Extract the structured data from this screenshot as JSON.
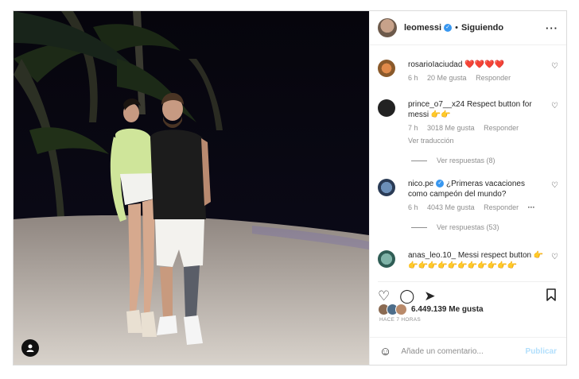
{
  "colors": {
    "accent": "#3897f0",
    "muted": "#8e8e8e",
    "publish_disabled": "#b2dffc"
  },
  "post": {
    "user_tag_icon": "person-icon",
    "header": {
      "username": "leomessi",
      "verified": "✓",
      "separator": "•",
      "follow_status": "Siguiendo",
      "more": "···"
    },
    "comments": [
      {
        "username": "rosarioIaciudad",
        "text": "❤️❤️❤️❤️",
        "time": "6 h",
        "likes": "20 Me gusta",
        "reply": "Responder"
      },
      {
        "username": "prince_o7__x24",
        "text": "Respect button for messi 👉👉",
        "time": "7 h",
        "likes": "3018 Me gusta",
        "reply": "Responder",
        "translate": "Ver traducción",
        "view_replies": "Ver respuestas (8)"
      },
      {
        "username": "nico.pe",
        "text": "¿Primeras vacaciones como campeón del mundo?",
        "time": "6 h",
        "likes": "4043 Me gusta",
        "reply": "Responder",
        "more": "···",
        "view_replies": "Ver respuestas (53)"
      },
      {
        "username": "anas_leo.10_",
        "text": "Messi respect button 👉👉👉👉👉👉👉👉👉👉👉👉"
      }
    ],
    "actions": {
      "like": "♡",
      "comment": "◯",
      "share": "➤",
      "save": "⌧"
    },
    "likes_count": "6.449.139 Me gusta",
    "time_ago": "HACE 7 HORAS",
    "add_comment": {
      "emoji": "☺",
      "placeholder": "Añade un comentario...",
      "publish": "Publicar"
    }
  }
}
